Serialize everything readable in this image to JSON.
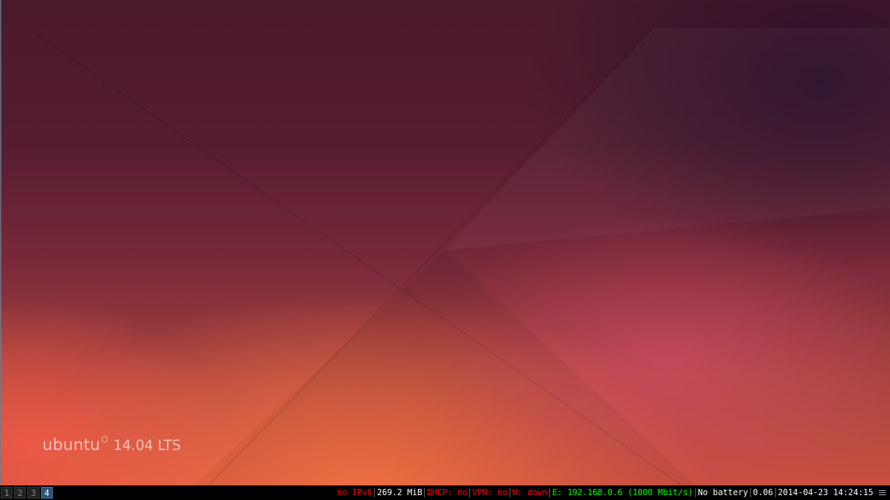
{
  "wallpaper": {
    "logo_word": "ubuntu",
    "logo_version": "14.04 LTS"
  },
  "workspaces": [
    {
      "label": "1",
      "focused": false
    },
    {
      "label": "2",
      "focused": false
    },
    {
      "label": "3",
      "focused": false
    },
    {
      "label": "4",
      "focused": true
    }
  ],
  "status": {
    "ipv6": {
      "text": "no IPv6",
      "color": "#ff0000"
    },
    "memory": {
      "text": "269.2 MiB",
      "color": "#ffffff"
    },
    "dhcp": {
      "text": "DHCP: no",
      "color": "#ff0000"
    },
    "vpn": {
      "text": "VPN: no",
      "color": "#ff0000"
    },
    "wireless": {
      "text": "W: down",
      "color": "#ff0000"
    },
    "ethernet": {
      "text": "E: 192.168.0.6 (1000 Mbit/s)",
      "color": "#00ff00"
    },
    "battery": {
      "text": "No battery",
      "color": "#ffffff"
    },
    "load": {
      "text": "0.06",
      "color": "#ffffff"
    },
    "time": {
      "text": "2014-04-23 14:24:15",
      "color": "#ffffff"
    }
  },
  "colors": {
    "bar_background": "#000000",
    "focused_workspace_bg": "#285577",
    "focused_workspace_border": "#4c7899",
    "inactive_workspace_bg": "#222222"
  },
  "icons": {
    "tray": "menu-icon"
  }
}
